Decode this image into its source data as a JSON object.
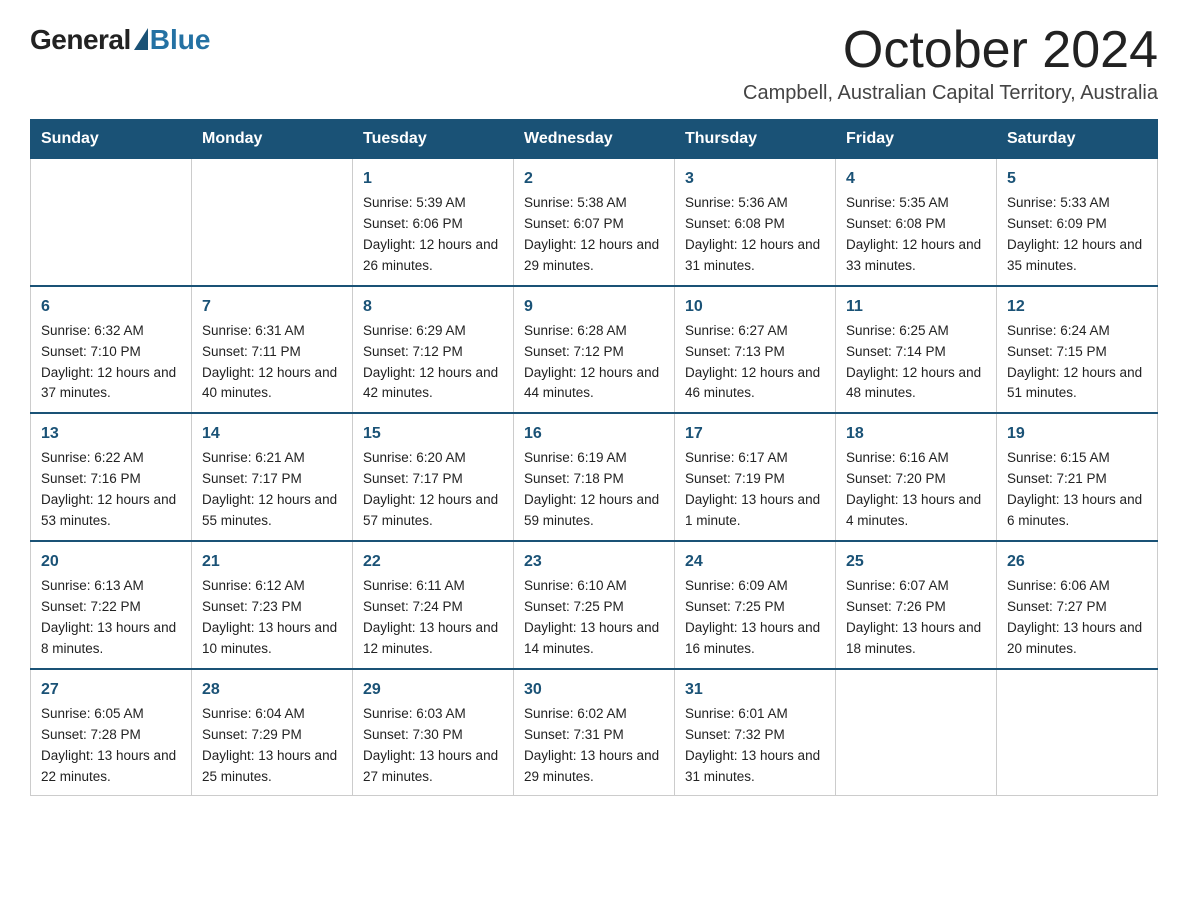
{
  "header": {
    "logo_general": "General",
    "logo_blue": "Blue",
    "month_title": "October 2024",
    "subtitle": "Campbell, Australian Capital Territory, Australia"
  },
  "weekdays": [
    "Sunday",
    "Monday",
    "Tuesday",
    "Wednesday",
    "Thursday",
    "Friday",
    "Saturday"
  ],
  "weeks": [
    [
      {
        "day": "",
        "sunrise": "",
        "sunset": "",
        "daylight": ""
      },
      {
        "day": "",
        "sunrise": "",
        "sunset": "",
        "daylight": ""
      },
      {
        "day": "1",
        "sunrise": "Sunrise: 5:39 AM",
        "sunset": "Sunset: 6:06 PM",
        "daylight": "Daylight: 12 hours and 26 minutes."
      },
      {
        "day": "2",
        "sunrise": "Sunrise: 5:38 AM",
        "sunset": "Sunset: 6:07 PM",
        "daylight": "Daylight: 12 hours and 29 minutes."
      },
      {
        "day": "3",
        "sunrise": "Sunrise: 5:36 AM",
        "sunset": "Sunset: 6:08 PM",
        "daylight": "Daylight: 12 hours and 31 minutes."
      },
      {
        "day": "4",
        "sunrise": "Sunrise: 5:35 AM",
        "sunset": "Sunset: 6:08 PM",
        "daylight": "Daylight: 12 hours and 33 minutes."
      },
      {
        "day": "5",
        "sunrise": "Sunrise: 5:33 AM",
        "sunset": "Sunset: 6:09 PM",
        "daylight": "Daylight: 12 hours and 35 minutes."
      }
    ],
    [
      {
        "day": "6",
        "sunrise": "Sunrise: 6:32 AM",
        "sunset": "Sunset: 7:10 PM",
        "daylight": "Daylight: 12 hours and 37 minutes."
      },
      {
        "day": "7",
        "sunrise": "Sunrise: 6:31 AM",
        "sunset": "Sunset: 7:11 PM",
        "daylight": "Daylight: 12 hours and 40 minutes."
      },
      {
        "day": "8",
        "sunrise": "Sunrise: 6:29 AM",
        "sunset": "Sunset: 7:12 PM",
        "daylight": "Daylight: 12 hours and 42 minutes."
      },
      {
        "day": "9",
        "sunrise": "Sunrise: 6:28 AM",
        "sunset": "Sunset: 7:12 PM",
        "daylight": "Daylight: 12 hours and 44 minutes."
      },
      {
        "day": "10",
        "sunrise": "Sunrise: 6:27 AM",
        "sunset": "Sunset: 7:13 PM",
        "daylight": "Daylight: 12 hours and 46 minutes."
      },
      {
        "day": "11",
        "sunrise": "Sunrise: 6:25 AM",
        "sunset": "Sunset: 7:14 PM",
        "daylight": "Daylight: 12 hours and 48 minutes."
      },
      {
        "day": "12",
        "sunrise": "Sunrise: 6:24 AM",
        "sunset": "Sunset: 7:15 PM",
        "daylight": "Daylight: 12 hours and 51 minutes."
      }
    ],
    [
      {
        "day": "13",
        "sunrise": "Sunrise: 6:22 AM",
        "sunset": "Sunset: 7:16 PM",
        "daylight": "Daylight: 12 hours and 53 minutes."
      },
      {
        "day": "14",
        "sunrise": "Sunrise: 6:21 AM",
        "sunset": "Sunset: 7:17 PM",
        "daylight": "Daylight: 12 hours and 55 minutes."
      },
      {
        "day": "15",
        "sunrise": "Sunrise: 6:20 AM",
        "sunset": "Sunset: 7:17 PM",
        "daylight": "Daylight: 12 hours and 57 minutes."
      },
      {
        "day": "16",
        "sunrise": "Sunrise: 6:19 AM",
        "sunset": "Sunset: 7:18 PM",
        "daylight": "Daylight: 12 hours and 59 minutes."
      },
      {
        "day": "17",
        "sunrise": "Sunrise: 6:17 AM",
        "sunset": "Sunset: 7:19 PM",
        "daylight": "Daylight: 13 hours and 1 minute."
      },
      {
        "day": "18",
        "sunrise": "Sunrise: 6:16 AM",
        "sunset": "Sunset: 7:20 PM",
        "daylight": "Daylight: 13 hours and 4 minutes."
      },
      {
        "day": "19",
        "sunrise": "Sunrise: 6:15 AM",
        "sunset": "Sunset: 7:21 PM",
        "daylight": "Daylight: 13 hours and 6 minutes."
      }
    ],
    [
      {
        "day": "20",
        "sunrise": "Sunrise: 6:13 AM",
        "sunset": "Sunset: 7:22 PM",
        "daylight": "Daylight: 13 hours and 8 minutes."
      },
      {
        "day": "21",
        "sunrise": "Sunrise: 6:12 AM",
        "sunset": "Sunset: 7:23 PM",
        "daylight": "Daylight: 13 hours and 10 minutes."
      },
      {
        "day": "22",
        "sunrise": "Sunrise: 6:11 AM",
        "sunset": "Sunset: 7:24 PM",
        "daylight": "Daylight: 13 hours and 12 minutes."
      },
      {
        "day": "23",
        "sunrise": "Sunrise: 6:10 AM",
        "sunset": "Sunset: 7:25 PM",
        "daylight": "Daylight: 13 hours and 14 minutes."
      },
      {
        "day": "24",
        "sunrise": "Sunrise: 6:09 AM",
        "sunset": "Sunset: 7:25 PM",
        "daylight": "Daylight: 13 hours and 16 minutes."
      },
      {
        "day": "25",
        "sunrise": "Sunrise: 6:07 AM",
        "sunset": "Sunset: 7:26 PM",
        "daylight": "Daylight: 13 hours and 18 minutes."
      },
      {
        "day": "26",
        "sunrise": "Sunrise: 6:06 AM",
        "sunset": "Sunset: 7:27 PM",
        "daylight": "Daylight: 13 hours and 20 minutes."
      }
    ],
    [
      {
        "day": "27",
        "sunrise": "Sunrise: 6:05 AM",
        "sunset": "Sunset: 7:28 PM",
        "daylight": "Daylight: 13 hours and 22 minutes."
      },
      {
        "day": "28",
        "sunrise": "Sunrise: 6:04 AM",
        "sunset": "Sunset: 7:29 PM",
        "daylight": "Daylight: 13 hours and 25 minutes."
      },
      {
        "day": "29",
        "sunrise": "Sunrise: 6:03 AM",
        "sunset": "Sunset: 7:30 PM",
        "daylight": "Daylight: 13 hours and 27 minutes."
      },
      {
        "day": "30",
        "sunrise": "Sunrise: 6:02 AM",
        "sunset": "Sunset: 7:31 PM",
        "daylight": "Daylight: 13 hours and 29 minutes."
      },
      {
        "day": "31",
        "sunrise": "Sunrise: 6:01 AM",
        "sunset": "Sunset: 7:32 PM",
        "daylight": "Daylight: 13 hours and 31 minutes."
      },
      {
        "day": "",
        "sunrise": "",
        "sunset": "",
        "daylight": ""
      },
      {
        "day": "",
        "sunrise": "",
        "sunset": "",
        "daylight": ""
      }
    ]
  ]
}
